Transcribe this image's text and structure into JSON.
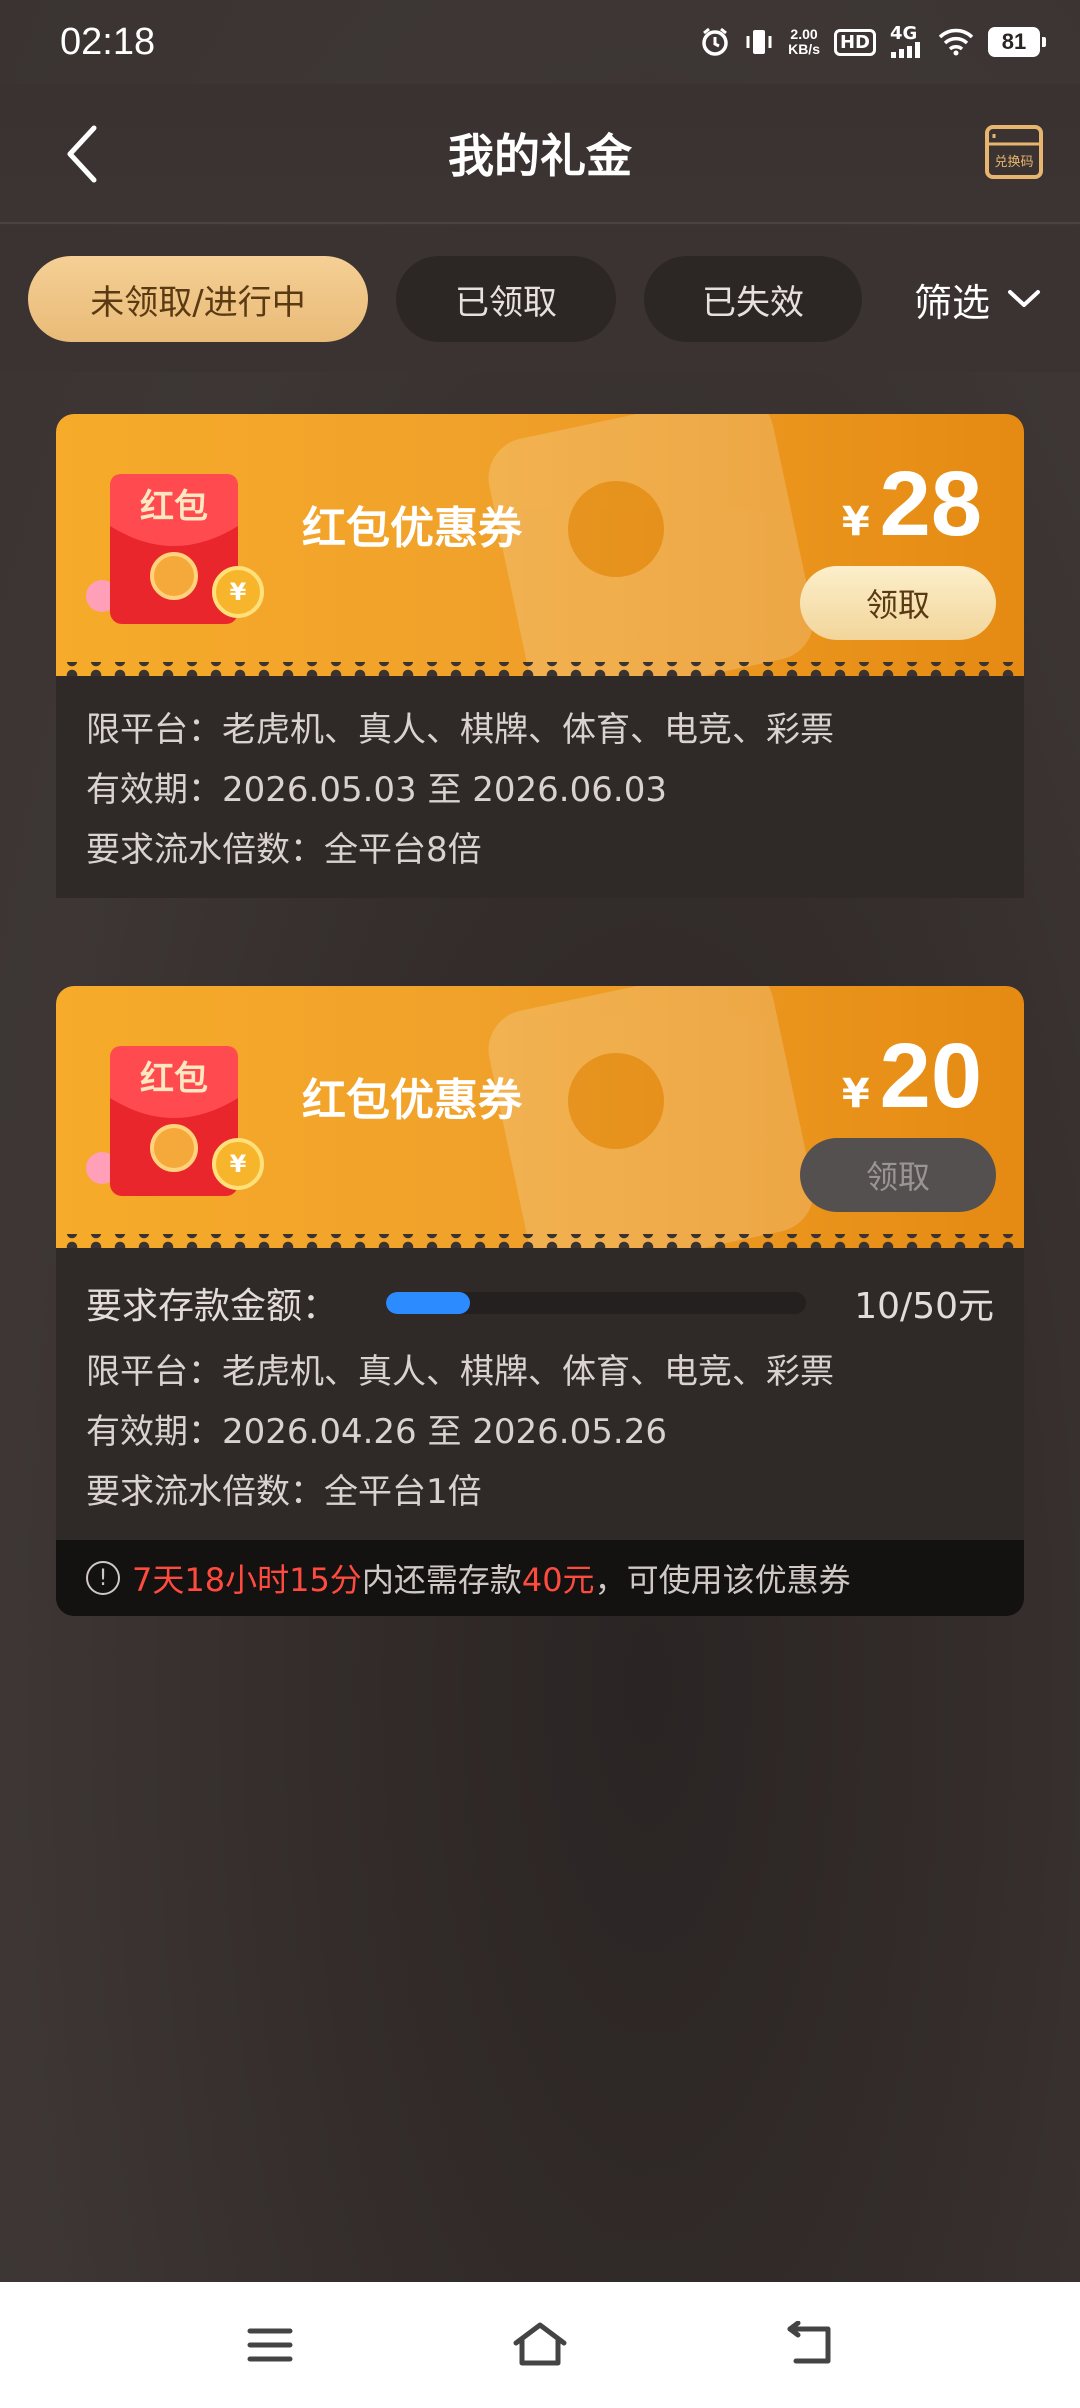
{
  "status_bar": {
    "time": "02:18",
    "speed_top": "2.00",
    "speed_unit": "KB/s",
    "hd": "HD",
    "network": "4G",
    "battery": "81"
  },
  "header": {
    "title": "我的礼金",
    "redeem_label": "兑换码"
  },
  "tabs": [
    {
      "label": "未领取/进行中",
      "active": true
    },
    {
      "label": "已领取",
      "active": false
    },
    {
      "label": "已失效",
      "active": false
    }
  ],
  "filter": {
    "label": "筛选"
  },
  "coupons": [
    {
      "name": "红包优惠券",
      "currency": "¥",
      "amount": "28",
      "button": "领取",
      "button_enabled": true,
      "platforms": "限平台：老虎机、真人、棋牌、体育、电竞、彩票",
      "validity": "有效期：2026.05.03 至 2026.06.03",
      "turnover": "要求流水倍数：全平台8倍"
    },
    {
      "name": "红包优惠券",
      "currency": "¥",
      "amount": "20",
      "button": "领取",
      "button_enabled": false,
      "deposit_label": "要求存款金额：",
      "deposit_progress": 0.2,
      "deposit_value": "10/50元",
      "platforms": "限平台：老虎机、真人、棋牌、体育、电竞、彩票",
      "validity": "有效期：2026.04.26 至 2026.05.26",
      "turnover": "要求流水倍数：全平台1倍",
      "notice": {
        "time_left": "7天18小时15分",
        "mid": "内还需存款",
        "amount": "40元",
        "tail": "，可使用该优惠券"
      }
    }
  ],
  "envelope_text": "红包",
  "colors": {
    "accent": "#f0a12a",
    "tab_active": "#efc386",
    "progress": "#2c8bff",
    "highlight": "#ff4b3e"
  }
}
